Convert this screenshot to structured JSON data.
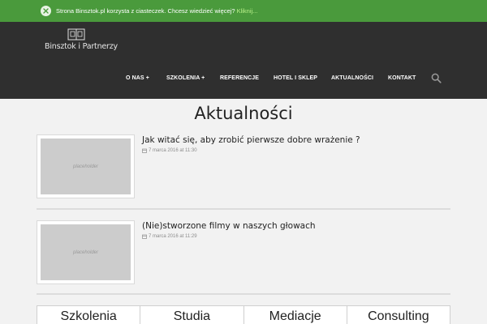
{
  "cookie_bar": {
    "text": "Strona Binsztok.pl korzysta z ciasteczek. Chcesz wiedzieć więcej? ",
    "link": "Kliknij..."
  },
  "header": {
    "logo_text": "Binsztok i Partnerzy",
    "nav": [
      "O NAS +",
      "SZKOLENIA +",
      "REFERENCJE",
      "HOTEL I SKLEP",
      "AKTUALNOŚCI",
      "KONTAKT"
    ]
  },
  "main": {
    "title": "Aktualności",
    "posts": [
      {
        "title": "Jak witać się, aby zrobić pierwsze dobre wrażenie ?",
        "date": "7 marca 2016 at 11:30",
        "thumb_label": "placeholder"
      },
      {
        "title": "(Nie)stworzone filmy w naszych głowach",
        "date": "7 marca 2016 at 11:29",
        "thumb_label": "placeholder"
      }
    ],
    "categories": [
      "Szkolenia",
      "Studia",
      "Mediacje",
      "Consulting"
    ]
  },
  "colors": {
    "cookie_bar": "#4a9a3c",
    "header": "#2f2f2f",
    "background": "#f2f2f2",
    "link_green": "#b9f08a"
  },
  "icons": {
    "cookie_close": "close-icon",
    "search": "search-icon",
    "date": "calendar-icon",
    "logo": "book-logo-icon"
  }
}
